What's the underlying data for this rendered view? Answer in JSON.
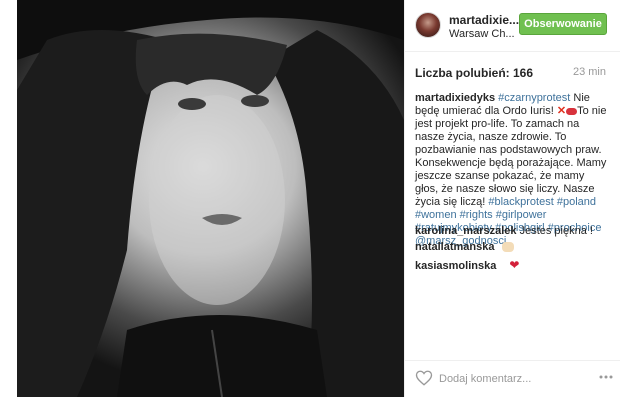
{
  "post": {
    "username": "martadixie...",
    "location": "Warsaw Ch...",
    "follow_label": "Obserwowanie",
    "likes": "Liczba polubień: 166",
    "time": "23 min"
  },
  "caption": {
    "author": "martadixiedyks",
    "t1": "#czarnyprotest",
    "t2": " Nie będę umierać dla Ordo Iuris! ",
    "t3": "To nie jest projekt pro-life. To zamach na nasze życia, nasze zdrowie. To pozbawianie nas podstawowych praw. Konsekwencje będą porażające. Mamy jeszcze szanse pokazać, że mamy głos, że nasze słowo się liczy. Nasze życia się liczą! ",
    "t4": "#blackprotest",
    "t5": "#poland #women #rights #girlpower #ratujmykobiety #polishgirl #prochoice @marsz_godnosci"
  },
  "comments": [
    {
      "author": "karolina_marszalek",
      "text": "Jestes piękna !"
    },
    {
      "author": "natallatmanska",
      "text": ""
    },
    {
      "author": "kasiasmolinska",
      "text": ""
    }
  ],
  "footer": {
    "add_comment_placeholder": "Dodaj komentarz..."
  },
  "colors": {
    "follow_button": "#70c050",
    "link": "#3f729b",
    "heart": "#d3203a"
  }
}
